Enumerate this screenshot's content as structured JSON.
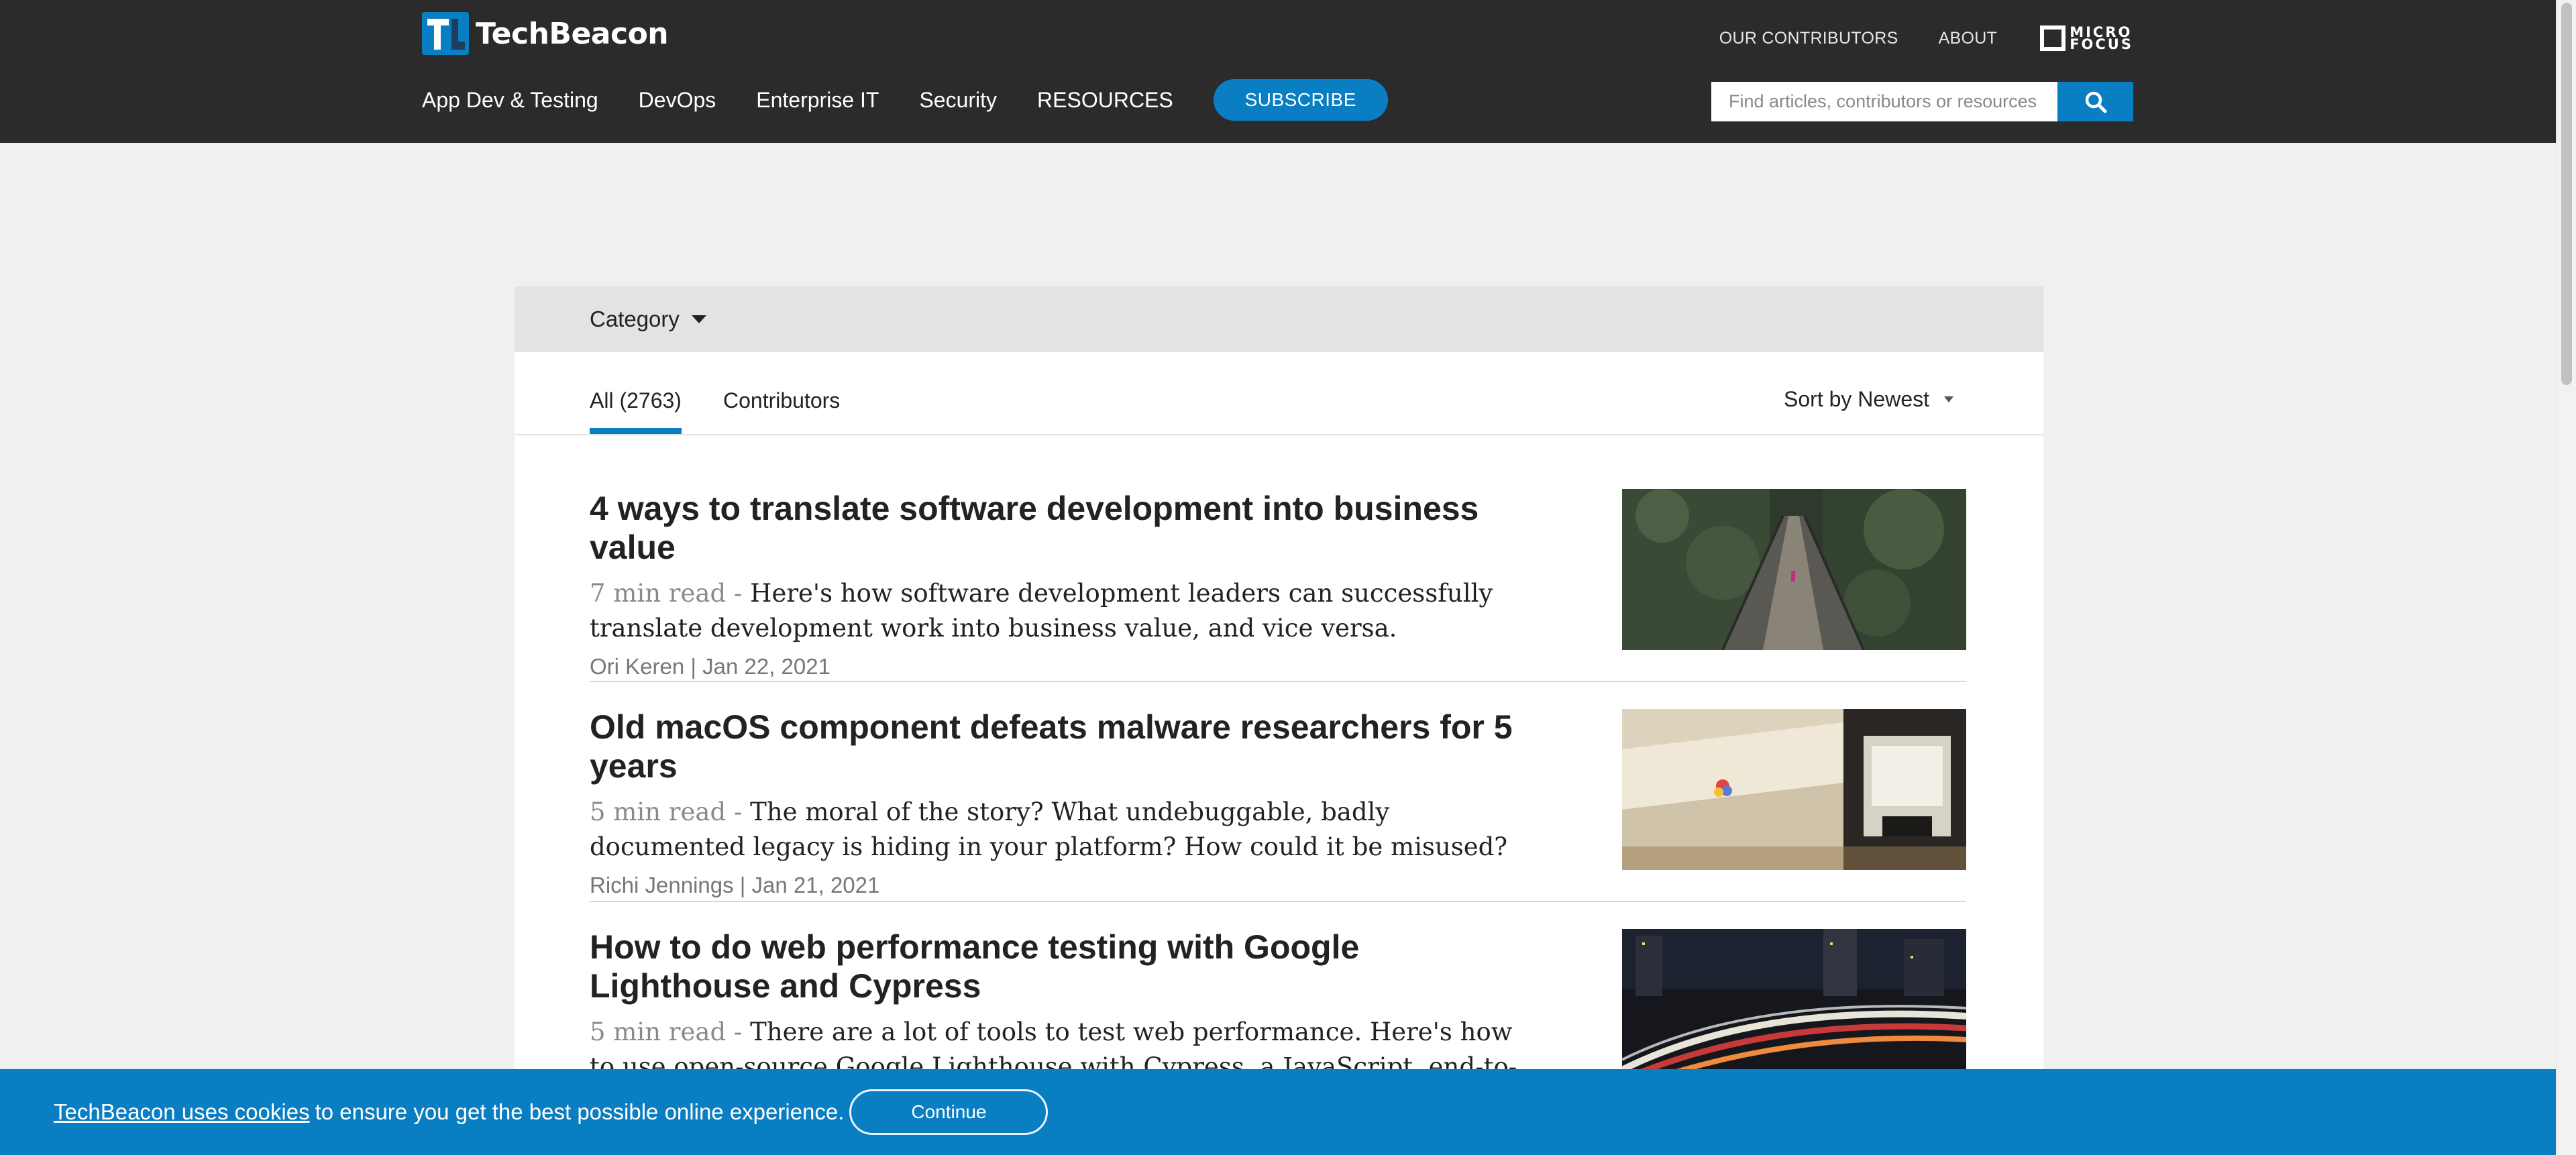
{
  "header": {
    "logo_text": "TechBeacon",
    "top_links": [
      "OUR CONTRIBUTORS",
      "ABOUT"
    ],
    "partner_logo": [
      "MICRO",
      "FOCUS"
    ],
    "nav": [
      "App Dev & Testing",
      "DevOps",
      "Enterprise IT",
      "Security",
      "RESOURCES"
    ],
    "subscribe_label": "SUBSCRIBE",
    "search": {
      "placeholder": "Find articles, contributors or resources",
      "icon": "search-icon"
    }
  },
  "filters": {
    "category_label": "Category",
    "tabs": [
      "All (2763)",
      "Contributors"
    ],
    "active_tab": "All (2763)",
    "sort_label": "Sort by Newest"
  },
  "articles": [
    {
      "title": "4 ways to translate software development into business value",
      "read_time": "7 min read - ",
      "summary": "Here's how software development leaders can successfully translate development work into business value, and vice versa.",
      "meta": "Ori Keren | Jan 22, 2021",
      "image": "suspension-bridge-photo"
    },
    {
      "title": "Old macOS component defeats malware researchers for 5 years",
      "read_time": "5 min read - ",
      "summary": "The moral of the story? What undebuggable, badly documented legacy is hiding in your platform? How could it be misused?",
      "meta": "Richi Jennings | Jan 21, 2021",
      "image": "vintage-macintosh-photo"
    },
    {
      "title": "How to do web performance testing with Google Lighthouse and Cypress",
      "read_time": "5 min read - ",
      "summary": "There are a lot of tools to test web performance. Here's how to use open-source Google Lighthouse with Cypress, a JavaScript, end-to-end testing tool.",
      "meta": "",
      "image": "night-highway-photo"
    }
  ],
  "cookie": {
    "link_text": "TechBeacon uses cookies",
    "text": "to ensure you get the best possible online experience.",
    "button": "Continue"
  },
  "colors": {
    "header_bg": "#2b2b2b",
    "accent": "#0a7ec2",
    "page_bg": "#f0f0f0"
  }
}
